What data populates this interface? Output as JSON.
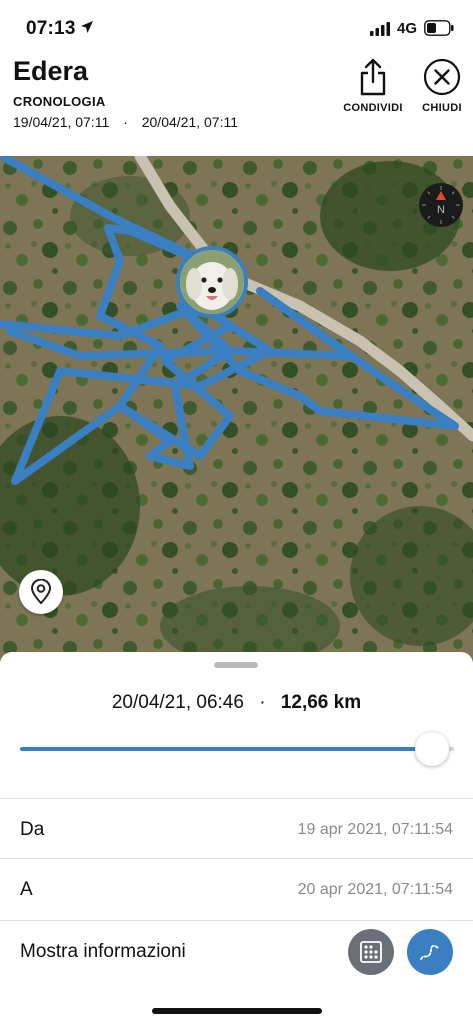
{
  "status": {
    "time": "07:13",
    "network": "4G"
  },
  "header": {
    "title": "Edera",
    "subtitle": "CRONOLOGIA",
    "range_start": "19/04/21, 07:11",
    "range_sep": "·",
    "range_end": "20/04/21, 07:11",
    "share_label": "CONDIVIDI",
    "close_label": "CHIUDI"
  },
  "map": {
    "compass_letter": "N",
    "track_color": "#3a7fc1"
  },
  "sheet": {
    "datetime": "20/04/21, 06:46",
    "sep": "·",
    "distance": "12,66 km",
    "slider_fraction": 0.95,
    "from_label": "Da",
    "from_value": "19 apr 2021, 07:11:54",
    "to_label": "A",
    "to_value": "20 apr 2021, 07:11:54",
    "info_label": "Mostra informazioni"
  },
  "icons": {
    "share": "share-icon",
    "close": "close-icon",
    "compass": "compass-icon",
    "pin": "location-pin-icon",
    "grid": "dots-grid-icon",
    "route": "route-icon"
  }
}
